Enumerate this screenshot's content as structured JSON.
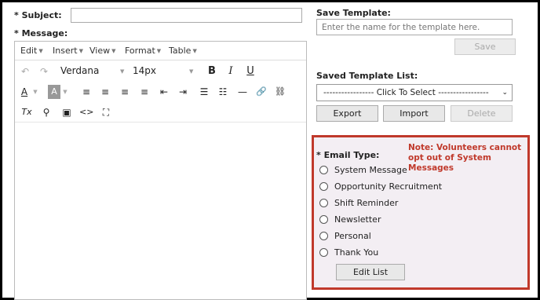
{
  "subject": {
    "label": "* Subject:"
  },
  "message": {
    "label": "* Message:"
  },
  "editor": {
    "menus": [
      "Edit",
      "Insert",
      "View",
      "Format",
      "Table"
    ],
    "font_family": "Verdana",
    "font_size": "14px",
    "toolbar_icons": {
      "undo": "↶",
      "redo": "↷",
      "bold": "B",
      "italic": "I",
      "underline": "U",
      "text_color": "A",
      "background_color": "A",
      "align_left": "≡",
      "align_center": "≡",
      "align_right": "≡",
      "align_justify": "≡",
      "outdent": "⇤",
      "indent": "⇥",
      "bullet_list": "☰",
      "numbered_list": "☷",
      "horizontal_rule": "—",
      "link": "🔗",
      "unlink": "⛓",
      "clear_formatting": "Tx",
      "find": "⚲",
      "image": "▣",
      "source_code": "<>",
      "fullscreen": "⛶"
    }
  },
  "save_template": {
    "label": "Save Template:",
    "placeholder": "Enter the name for the template here.",
    "save_button": "Save"
  },
  "saved_templates": {
    "label": "Saved Template List:",
    "selected": "----------------- Click To Select -----------------",
    "export_button": "Export",
    "import_button": "Import",
    "delete_button": "Delete"
  },
  "email_type": {
    "label": "* Email Type:",
    "note": "Note: Volunteers cannot opt out of System Messages",
    "options": [
      "System Message",
      "Opportunity Recruitment",
      "Shift Reminder",
      "Newsletter",
      "Personal",
      "Thank You"
    ],
    "edit_button": "Edit List"
  }
}
